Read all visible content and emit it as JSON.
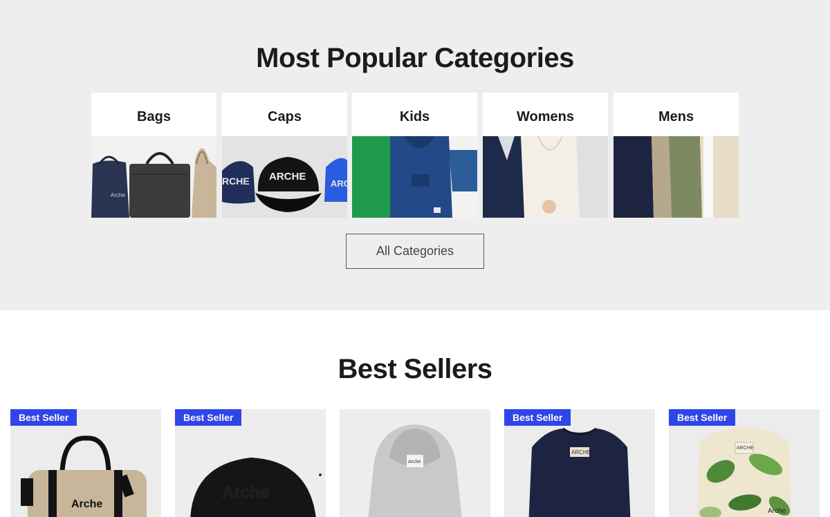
{
  "popular": {
    "title": "Most Popular Categories",
    "categories": [
      {
        "label": "Bags"
      },
      {
        "label": "Caps"
      },
      {
        "label": "Kids"
      },
      {
        "label": "Womens"
      },
      {
        "label": "Mens"
      }
    ],
    "all_button": "All Categories"
  },
  "sellers": {
    "title": "Best Sellers",
    "products": [
      {
        "badge": "Best Seller",
        "name": "duffel-bag"
      },
      {
        "badge": "Best Seller",
        "name": "black-cap"
      },
      {
        "badge": "",
        "name": "grey-hoodie"
      },
      {
        "badge": "Best Seller",
        "name": "navy-tee"
      },
      {
        "badge": "Best Seller",
        "name": "tropical-shirt"
      }
    ]
  },
  "brand_text": {
    "caps": "ARCHE",
    "caps_left": "RCHE",
    "caps_right": "ARC",
    "logo": "Arche"
  },
  "colors": {
    "badge_bg": "#2f45e8",
    "section_bg": "#eeeeee"
  }
}
